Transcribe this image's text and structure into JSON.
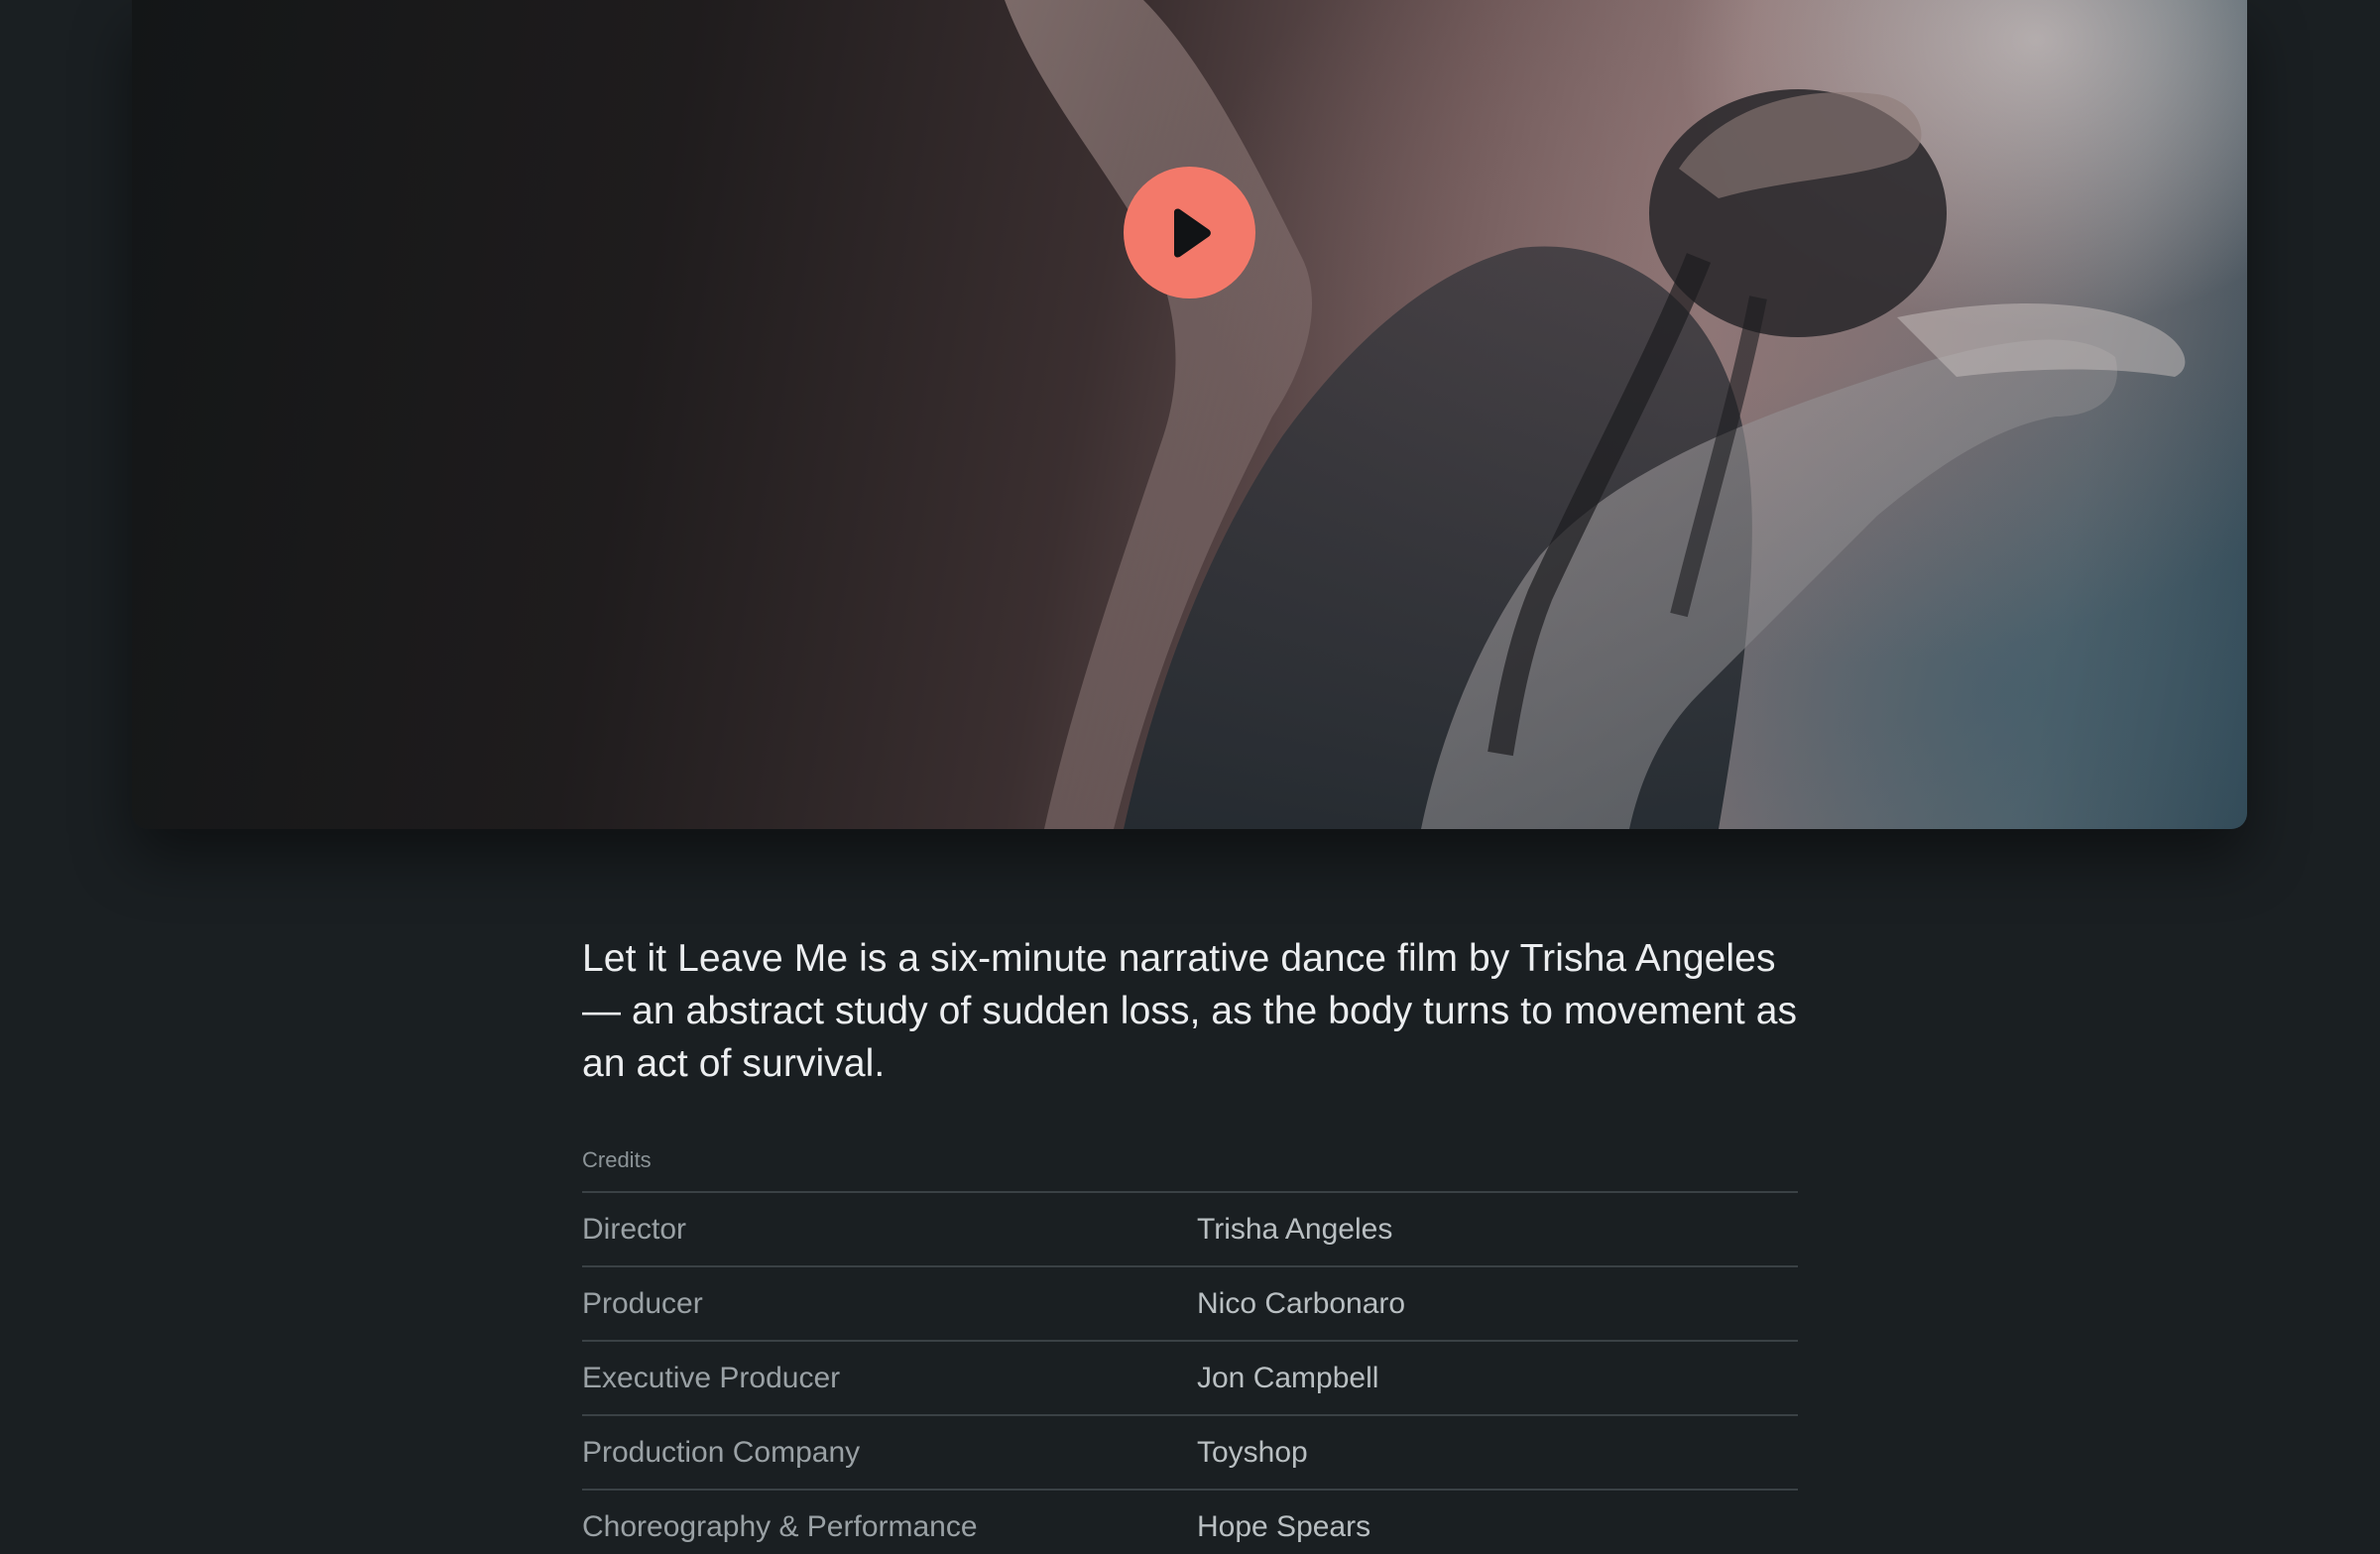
{
  "video": {
    "play_icon": "play-icon",
    "accent_color": "#f3796a"
  },
  "description": "Let it Leave Me is a six-minute narrative dance film by Trisha Angeles — an abstract study of sudden loss, as the body turns to movement as an act of survival.",
  "credits": {
    "label": "Credits",
    "rows": [
      {
        "role": "Director",
        "name": "Trisha Angeles"
      },
      {
        "role": "Producer",
        "name": "Nico Carbonaro"
      },
      {
        "role": "Executive Producer",
        "name": "Jon Campbell"
      },
      {
        "role": "Production Company",
        "name": "Toyshop"
      },
      {
        "role": "Choreography & Performance",
        "name": "Hope Spears"
      }
    ]
  }
}
